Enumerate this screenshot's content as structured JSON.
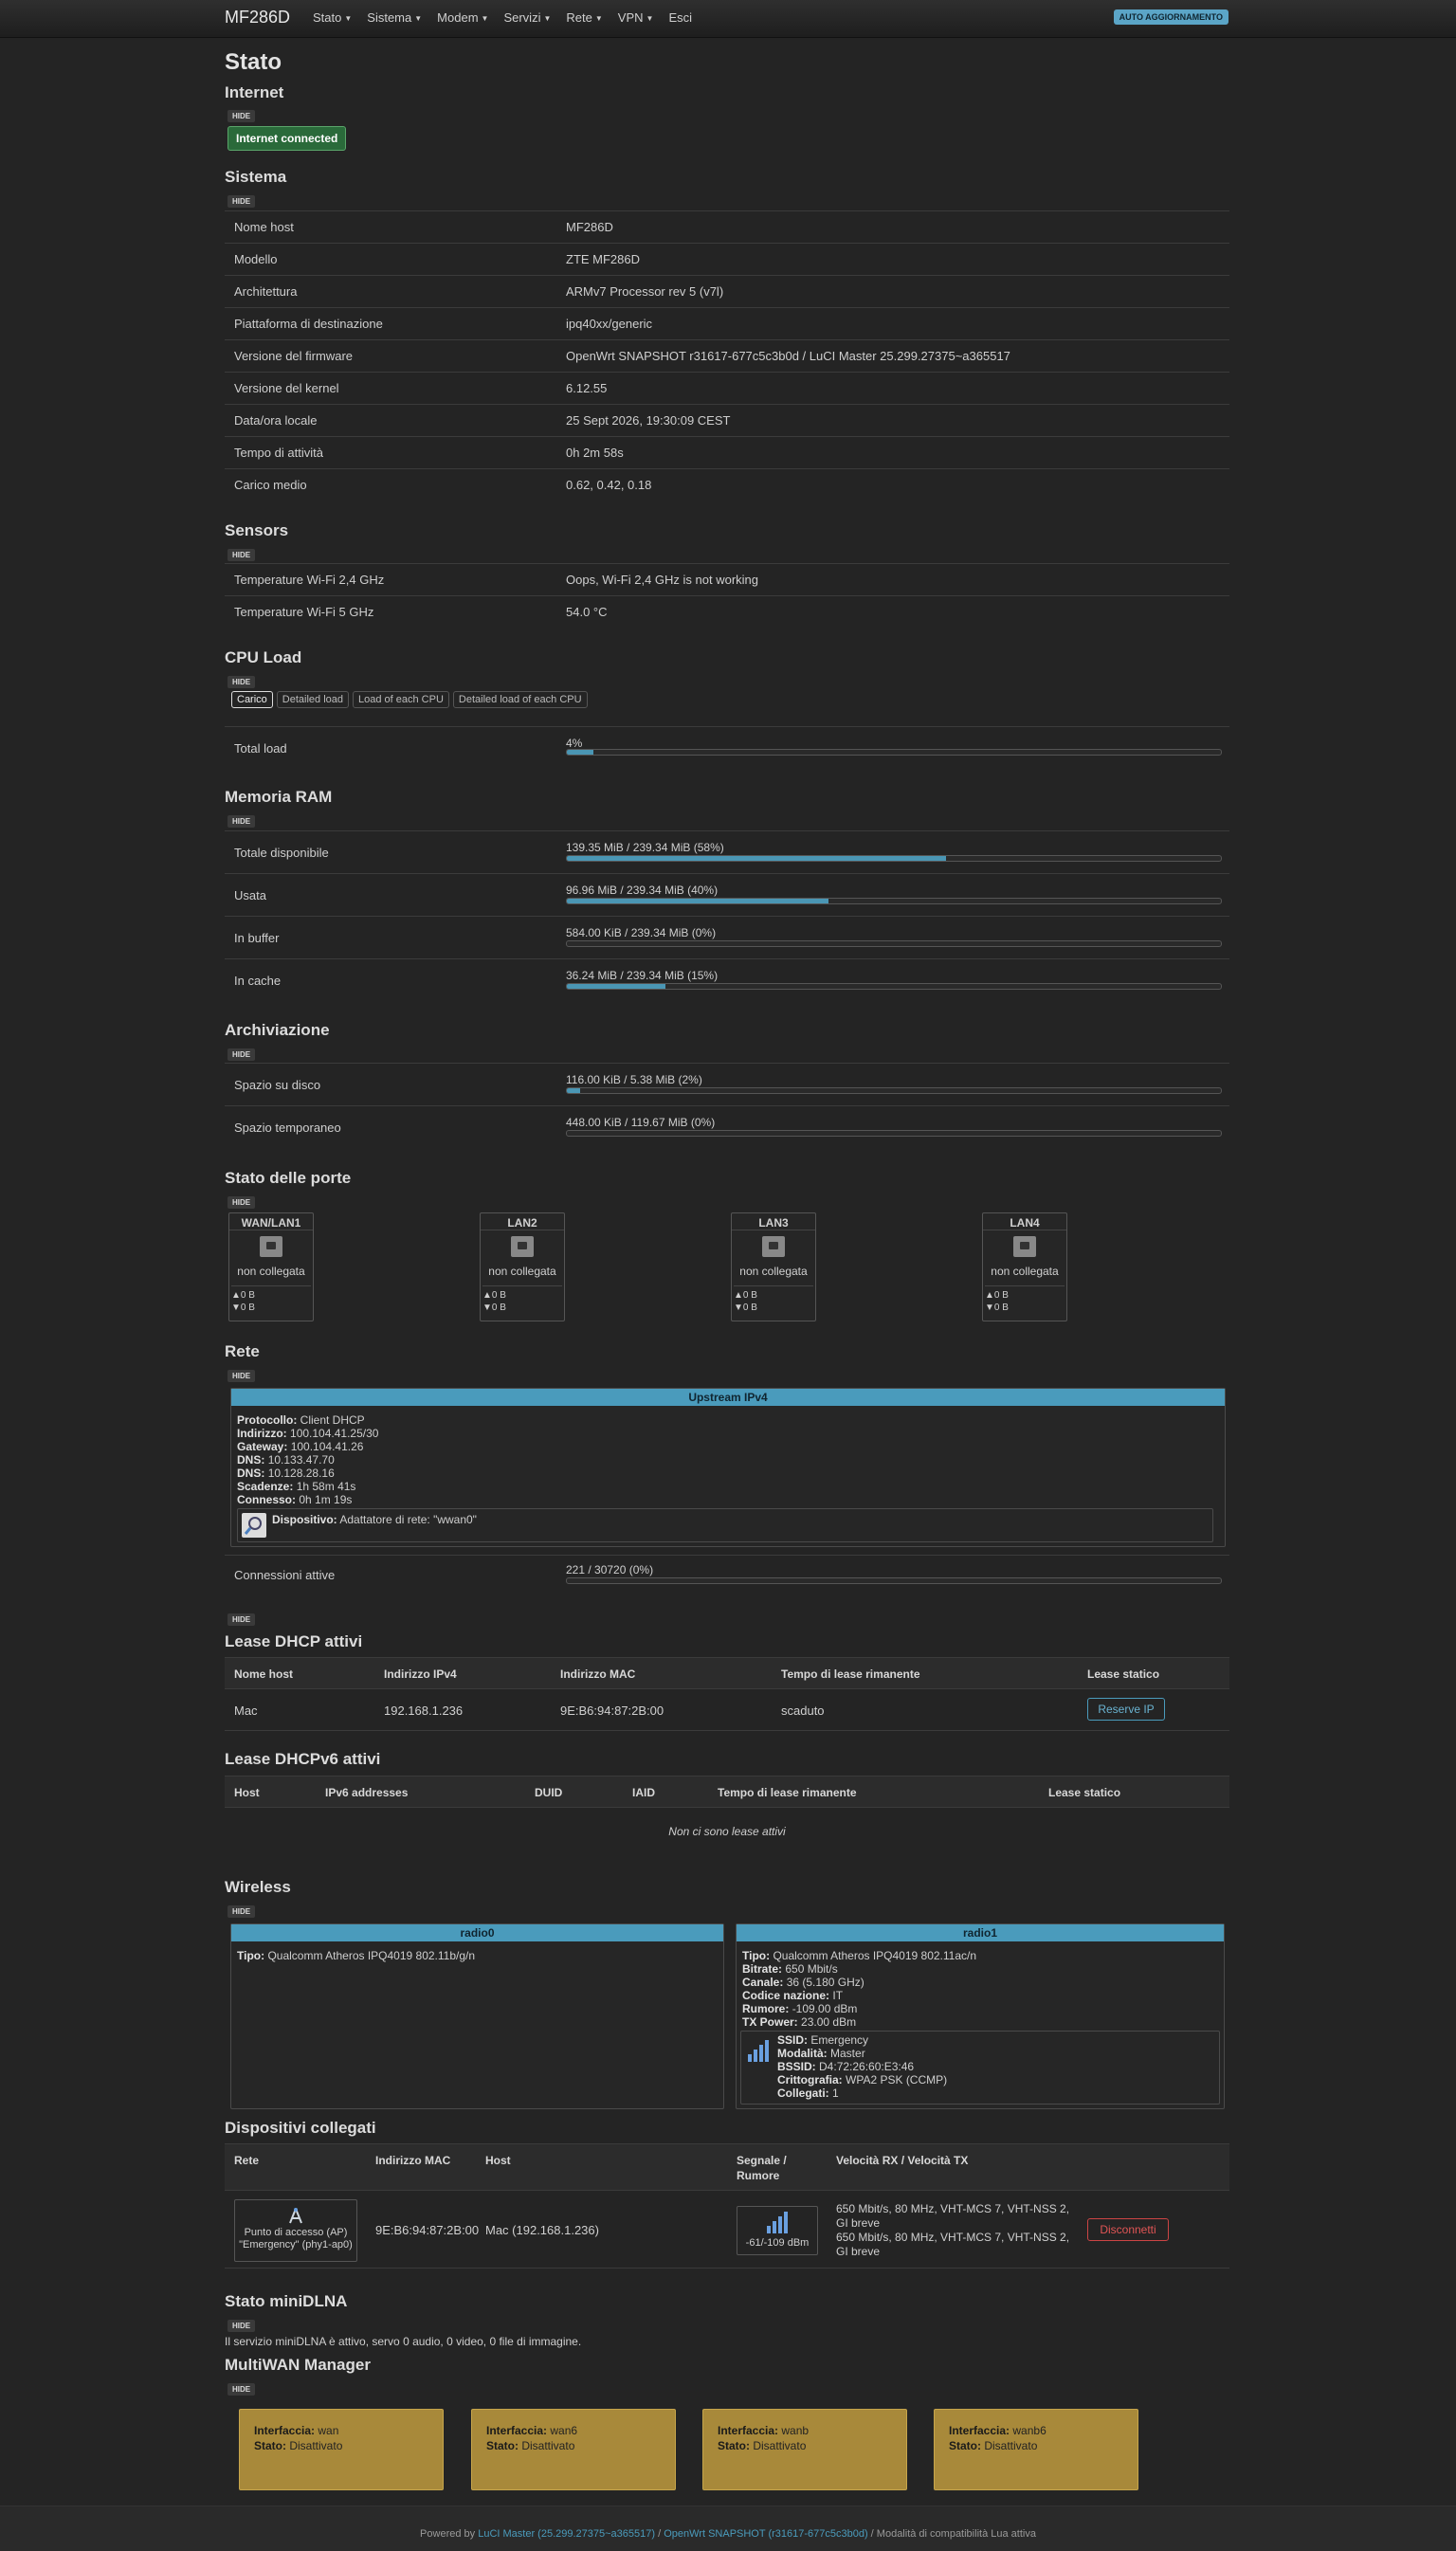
{
  "header": {
    "brand": "MF286D",
    "menu": [
      "Stato",
      "Sistema",
      "Modem",
      "Servizi",
      "Rete",
      "VPN",
      "Esci"
    ],
    "auto_refresh": "AUTO AGGIORNAMENTO"
  },
  "page_title": "Stato",
  "hide_label": "HIDE",
  "internet": {
    "title": "Internet",
    "status": "Internet connected"
  },
  "sistema": {
    "title": "Sistema",
    "rows": [
      {
        "k": "Nome host",
        "v": "MF286D"
      },
      {
        "k": "Modello",
        "v": "ZTE MF286D"
      },
      {
        "k": "Architettura",
        "v": "ARMv7 Processor rev 5 (v7l)"
      },
      {
        "k": "Piattaforma di destinazione",
        "v": "ipq40xx/generic"
      },
      {
        "k": "Versione del firmware",
        "v": "OpenWrt SNAPSHOT r31617-677c5c3b0d / LuCI Master 25.299.27375~a365517"
      },
      {
        "k": "Versione del kernel",
        "v": "6.12.55"
      },
      {
        "k": "Data/ora locale",
        "v": "25 Sept 2026, 19:30:09 CEST"
      },
      {
        "k": "Tempo di attività",
        "v": "0h 2m 58s"
      },
      {
        "k": "Carico medio",
        "v": "0.62, 0.42, 0.18"
      }
    ]
  },
  "sensors": {
    "title": "Sensors",
    "rows": [
      {
        "k": "Temperature Wi-Fi 2,4 GHz",
        "v": "Oops, Wi-Fi 2,4 GHz is not working"
      },
      {
        "k": "Temperature Wi-Fi 5 GHz",
        "v": "54.0 °C"
      }
    ]
  },
  "cpu": {
    "title": "CPU Load",
    "tabs": [
      "Carico",
      "Detailed load",
      "Load of each CPU",
      "Detailed load of each CPU"
    ],
    "label": "Total load",
    "text": "4%",
    "percent": 4
  },
  "ram": {
    "title": "Memoria RAM",
    "rows": [
      {
        "k": "Totale disponibile",
        "text": "139.35 MiB / 239.34 MiB (58%)",
        "percent": 58
      },
      {
        "k": "Usata",
        "text": "96.96 MiB / 239.34 MiB (40%)",
        "percent": 40
      },
      {
        "k": "In buffer",
        "text": "584.00 KiB / 239.34 MiB (0%)",
        "percent": 0
      },
      {
        "k": "In cache",
        "text": "36.24 MiB / 239.34 MiB (15%)",
        "percent": 15
      }
    ]
  },
  "storage": {
    "title": "Archiviazione",
    "rows": [
      {
        "k": "Spazio su disco",
        "text": "116.00 KiB / 5.38 MiB (2%)",
        "percent": 2
      },
      {
        "k": "Spazio temporaneo",
        "text": "448.00 KiB / 119.67 MiB (0%)",
        "percent": 0
      }
    ]
  },
  "ports": {
    "title": "Stato delle porte",
    "items": [
      {
        "name": "WAN/LAN1",
        "status": "non collegata",
        "tx": "▲0 B",
        "rx": "▼0 B"
      },
      {
        "name": "LAN2",
        "status": "non collegata",
        "tx": "▲0 B",
        "rx": "▼0 B"
      },
      {
        "name": "LAN3",
        "status": "non collegata",
        "tx": "▲0 B",
        "rx": "▼0 B"
      },
      {
        "name": "LAN4",
        "status": "non collegata",
        "tx": "▲0 B",
        "rx": "▼0 B"
      }
    ]
  },
  "rete": {
    "title": "Rete",
    "upstream_title": "Upstream IPv4",
    "upstream": [
      {
        "k": "Protocollo:",
        "v": "Client DHCP"
      },
      {
        "k": "Indirizzo:",
        "v": "100.104.41.25/30"
      },
      {
        "k": "Gateway:",
        "v": "100.104.41.26"
      },
      {
        "k": "DNS:",
        "v": "10.133.47.70"
      },
      {
        "k": "DNS:",
        "v": "10.128.28.16"
      },
      {
        "k": "Scadenze:",
        "v": "1h 58m 41s"
      },
      {
        "k": "Connesso:",
        "v": "0h 1m 19s"
      }
    ],
    "device_label": "Dispositivo:",
    "device_value": "Adattatore di rete: \"wwan0\"",
    "conn_label": "Connessioni attive",
    "conn_text": "221 / 30720 (0%)",
    "conn_percent": 0
  },
  "dhcp": {
    "title": "Lease DHCP attivi",
    "headers": [
      "Nome host",
      "Indirizzo IPv4",
      "Indirizzo MAC",
      "Tempo di lease rimanente",
      "Lease statico"
    ],
    "rows": [
      {
        "host": "Mac",
        "ip": "192.168.1.236",
        "mac": "9E:B6:94:87:2B:00",
        "time": "scaduto",
        "button": "Reserve IP"
      }
    ]
  },
  "dhcp6": {
    "title": "Lease DHCPv6 attivi",
    "headers": [
      "Host",
      "IPv6 addresses",
      "DUID",
      "IAID",
      "Tempo di lease rimanente",
      "Lease statico"
    ],
    "empty": "Non ci sono lease attivi"
  },
  "wireless": {
    "title": "Wireless",
    "radio0": {
      "title": "radio0",
      "tipo_k": "Tipo:",
      "tipo_v": "Qualcomm Atheros IPQ4019 802.11b/g/n"
    },
    "radio1": {
      "title": "radio1",
      "info": [
        {
          "k": "Tipo:",
          "v": "Qualcomm Atheros IPQ4019 802.11ac/n"
        },
        {
          "k": "Bitrate:",
          "v": "650 Mbit/s"
        },
        {
          "k": "Canale:",
          "v": "36 (5.180 GHz)"
        },
        {
          "k": "Codice nazione:",
          "v": "IT"
        },
        {
          "k": "Rumore:",
          "v": "-109.00 dBm"
        },
        {
          "k": "TX Power:",
          "v": "23.00 dBm"
        }
      ],
      "ssid": [
        {
          "k": "SSID:",
          "v": "Emergency"
        },
        {
          "k": "Modalità:",
          "v": "Master"
        },
        {
          "k": "BSSID:",
          "v": "D4:72:26:60:E3:46"
        },
        {
          "k": "Crittografia:",
          "v": "WPA2 PSK (CCMP)"
        },
        {
          "k": "Collegati:",
          "v": "1"
        }
      ]
    }
  },
  "assoc": {
    "title": "Dispositivi collegati",
    "headers": [
      "Rete",
      "Indirizzo MAC",
      "Host",
      "Segnale /",
      "Rumore",
      "Velocità RX / Velocità TX"
    ],
    "row": {
      "ap1": "Punto di accesso (AP)",
      "ap2": "\"Emergency\" (phy1-ap0)",
      "mac": "9E:B6:94:87:2B:00",
      "host": "Mac (192.168.1.236)",
      "signal": "-61/-109 dBm",
      "rx1": "650 Mbit/s, 80 MHz, VHT-MCS 7, VHT-NSS 2,",
      "rx2": "GI breve",
      "tx1": "650 Mbit/s, 80 MHz, VHT-MCS 7, VHT-NSS 2,",
      "tx2": "GI breve",
      "button": "Disconnetti"
    }
  },
  "dlna": {
    "title": "Stato miniDLNA",
    "text": "Il servizio miniDLNA è attivo, servo 0 audio, 0 video, 0 file di immagine."
  },
  "mwan": {
    "title": "MultiWAN Manager",
    "items": [
      {
        "k1": "Interfaccia:",
        "v1": "wan",
        "k2": "Stato:",
        "v2": "Disattivato"
      },
      {
        "k1": "Interfaccia:",
        "v1": "wan6",
        "k2": "Stato:",
        "v2": "Disattivato"
      },
      {
        "k1": "Interfaccia:",
        "v1": "wanb",
        "k2": "Stato:",
        "v2": "Disattivato"
      },
      {
        "k1": "Interfaccia:",
        "v1": "wanb6",
        "k2": "Stato:",
        "v2": "Disattivato"
      }
    ]
  },
  "footer": {
    "prefix": "Powered by ",
    "luci": "LuCI Master (25.299.27375~a365517)",
    "sep": " / ",
    "openwrt": "OpenWrt SNAPSHOT (r31617-677c5c3b0d)",
    "suffix": " / Modalità di compatibilità Lua attiva"
  },
  "colors": {
    "background": "#242424",
    "accent": "#4a9bbc",
    "success": "#2a6a3a",
    "danger": "#cc4444",
    "mwan": "#a8893a"
  }
}
